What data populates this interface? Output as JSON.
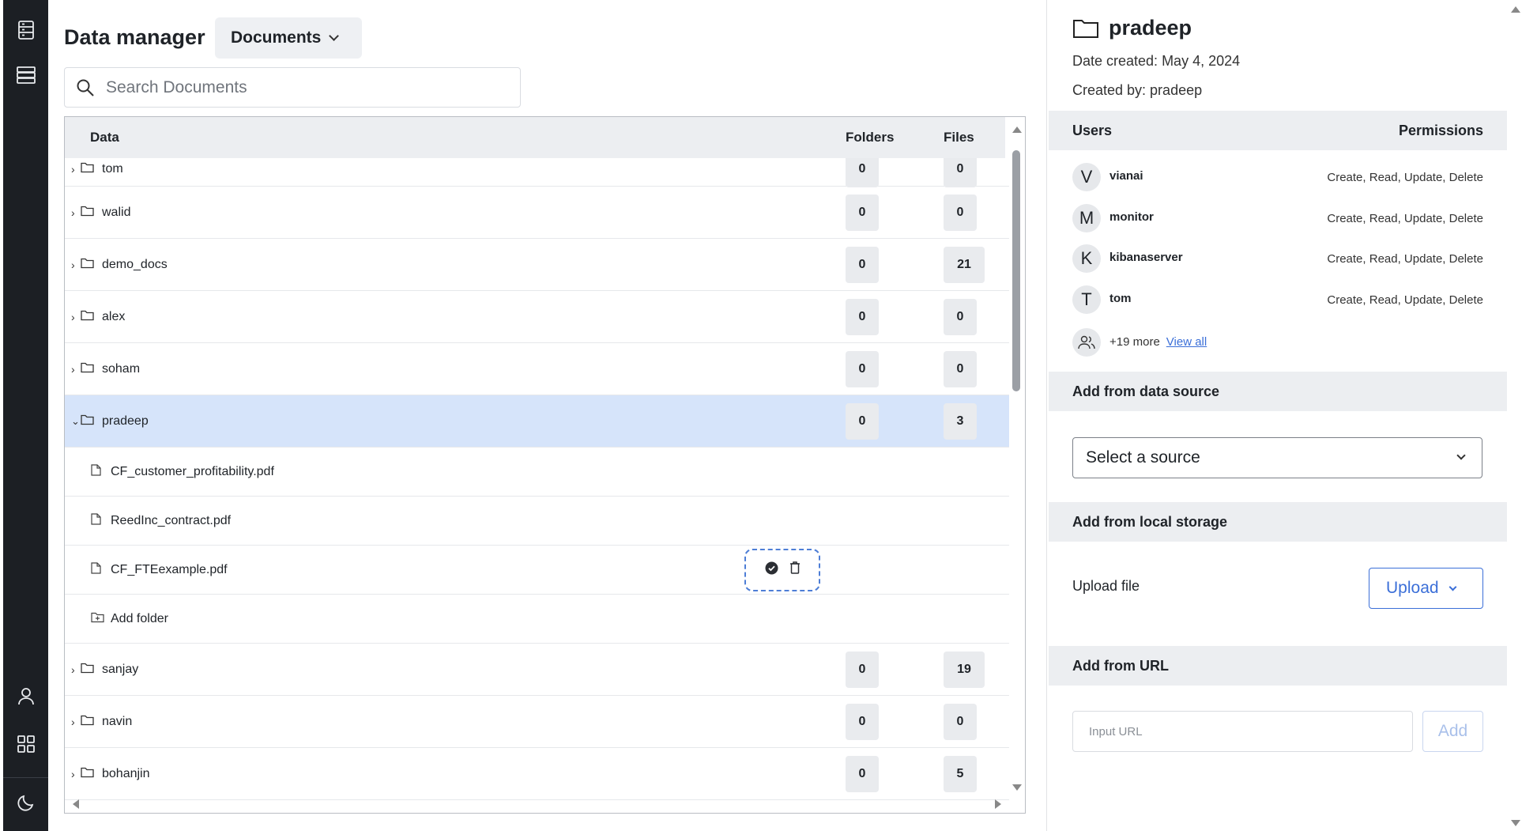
{
  "header": {
    "title": "Data manager",
    "collection": "Documents"
  },
  "search": {
    "placeholder": "Search Documents"
  },
  "table": {
    "columns": {
      "data": "Data",
      "folders": "Folders",
      "files": "Files"
    },
    "folders_before": [
      {
        "name": "tom",
        "folders": "0",
        "files": "0"
      },
      {
        "name": "walid",
        "folders": "0",
        "files": "0"
      },
      {
        "name": "demo_docs",
        "folders": "0",
        "files": "21"
      },
      {
        "name": "alex",
        "folders": "0",
        "files": "0"
      },
      {
        "name": "soham",
        "folders": "0",
        "files": "0"
      }
    ],
    "selected": {
      "name": "pradeep",
      "folders": "0",
      "files": "3"
    },
    "files": [
      "CF_customer_profitability.pdf",
      "ReedInc_contract.pdf",
      "CF_FTEexample.pdf"
    ],
    "add_folder": "Add folder",
    "folders_after": [
      {
        "name": "sanjay",
        "folders": "0",
        "files": "19"
      },
      {
        "name": "navin",
        "folders": "0",
        "files": "0"
      },
      {
        "name": "bohanjin",
        "folders": "0",
        "files": "5"
      }
    ]
  },
  "panel": {
    "title": "pradeep",
    "date_created": "Date created: May 4, 2024",
    "created_by": "Created by: pradeep",
    "users_header": "Users",
    "permissions_header": "Permissions",
    "users": [
      {
        "initial": "V",
        "name": "vianai",
        "perms": "Create, Read, Update, Delete"
      },
      {
        "initial": "M",
        "name": "monitor",
        "perms": "Create, Read, Update, Delete"
      },
      {
        "initial": "K",
        "name": "kibanaserver",
        "perms": "Create, Read, Update, Delete"
      },
      {
        "initial": "T",
        "name": "tom",
        "perms": "Create, Read, Update, Delete"
      }
    ],
    "more_users": "+19 more",
    "view_all": "View all",
    "data_source": {
      "header": "Add from data source",
      "select": "Select a source"
    },
    "local_storage": {
      "header": "Add from local storage",
      "label": "Upload file",
      "button": "Upload"
    },
    "url": {
      "header": "Add from URL",
      "placeholder": "Input URL",
      "button": "Add"
    }
  },
  "colors": {
    "accent": "#3b6fd8",
    "selected_row": "#d6e4fa",
    "rail": "#1c1f24"
  }
}
